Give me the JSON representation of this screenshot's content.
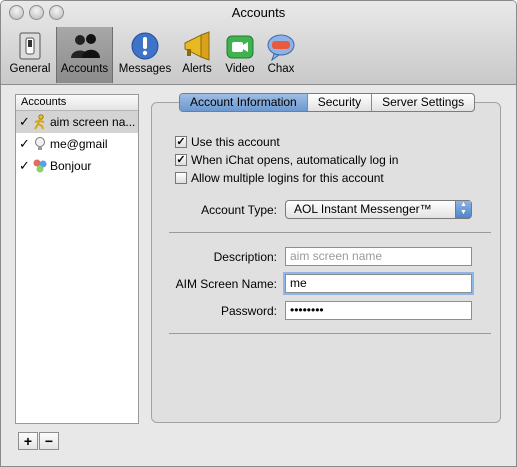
{
  "window": {
    "title": "Accounts"
  },
  "toolbar": {
    "items": [
      {
        "label": "General",
        "icon": "switch-icon"
      },
      {
        "label": "Accounts",
        "icon": "people-icon"
      },
      {
        "label": "Messages",
        "icon": "exclamation-icon"
      },
      {
        "label": "Alerts",
        "icon": "megaphone-icon"
      },
      {
        "label": "Video",
        "icon": "video-camera-icon"
      },
      {
        "label": "Chax",
        "icon": "chax-icon"
      }
    ],
    "selected": "Accounts"
  },
  "accounts_list": {
    "header": "Accounts",
    "items": [
      {
        "label": "aim screen na...",
        "checked": true,
        "icon": "aim-running-man-icon",
        "selected": true
      },
      {
        "label": "me@gmail",
        "checked": true,
        "icon": "lightbulb-icon",
        "selected": false
      },
      {
        "label": "Bonjour",
        "checked": true,
        "icon": "bonjour-icon",
        "selected": false
      }
    ],
    "add_label": "+",
    "remove_label": "−"
  },
  "tabs": {
    "items": [
      "Account Information",
      "Security",
      "Server Settings"
    ],
    "selected": "Account Information"
  },
  "options": {
    "use_account": {
      "label": "Use this account",
      "checked": true
    },
    "auto_login": {
      "label": "When iChat opens, automatically log in",
      "checked": true
    },
    "multiple_logins": {
      "label": "Allow multiple logins for this account",
      "checked": false
    }
  },
  "account_type": {
    "label": "Account Type:",
    "value": "AOL Instant Messenger™"
  },
  "description": {
    "label": "Description:",
    "placeholder": "aim screen name",
    "value": ""
  },
  "screen_name": {
    "label": "AIM Screen Name:",
    "value": "me"
  },
  "password": {
    "label": "Password:",
    "value": "••••••••"
  },
  "colors": {
    "tab_selected": "#7ea6d8",
    "popup_arrow": "#5e90cf",
    "focus_ring": "#8fb6e8"
  }
}
